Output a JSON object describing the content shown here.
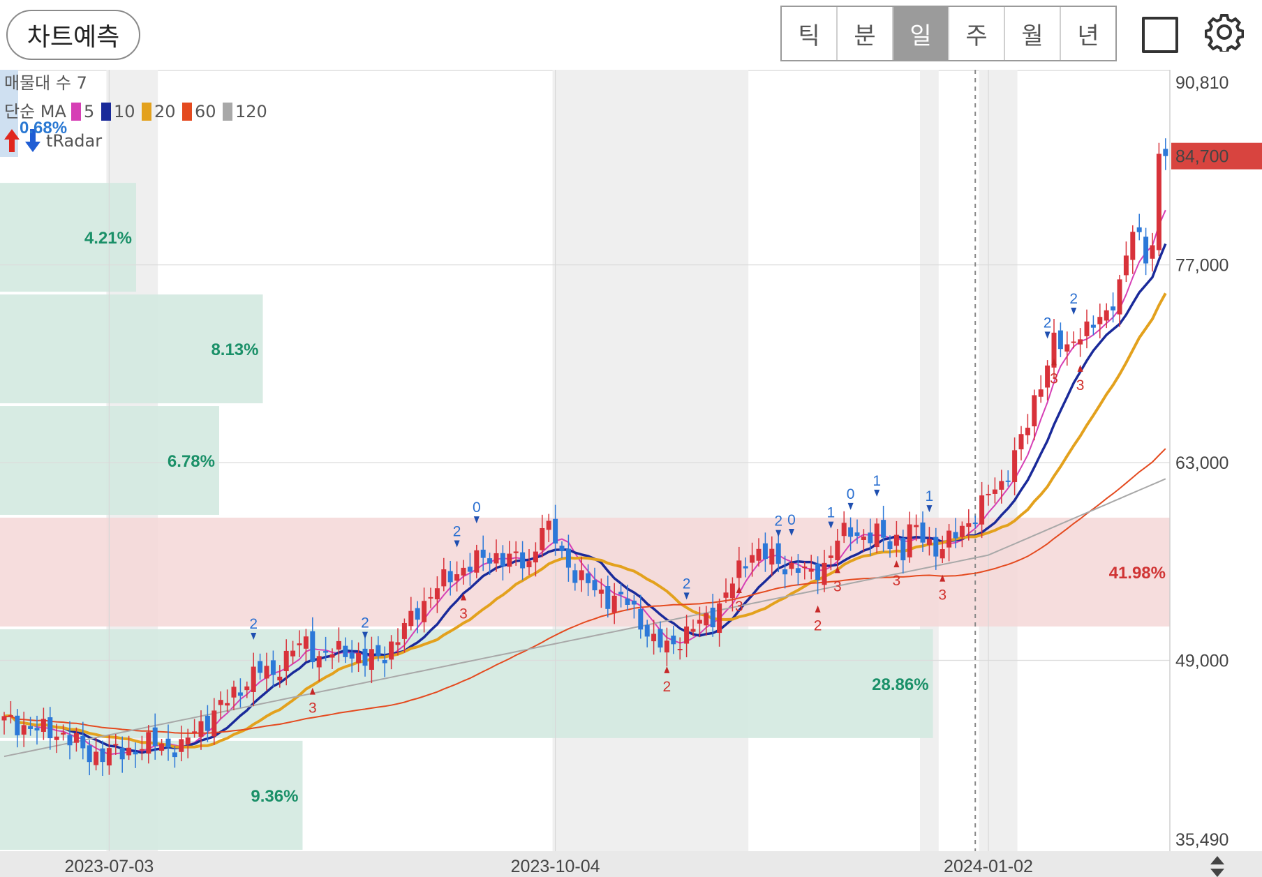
{
  "toolbar": {
    "predict_label": "차트예측",
    "tabs": [
      {
        "label": "틱",
        "active": false
      },
      {
        "label": "분",
        "active": false
      },
      {
        "label": "일",
        "active": true
      },
      {
        "label": "주",
        "active": false
      },
      {
        "label": "월",
        "active": false
      },
      {
        "label": "년",
        "active": false
      }
    ],
    "square_icon": "square-icon",
    "settings_icon": "gear-icon"
  },
  "legend": {
    "volume_profile_label": "매물대 수 7",
    "ma_label": "단순 MA",
    "ma_periods": [
      "5",
      "10",
      "20",
      "60",
      "120"
    ],
    "ma_colors": [
      "#d63fb5",
      "#1a2a9a",
      "#e3a11d",
      "#e44a1f",
      "#a8a8a8"
    ],
    "signal_label": "tRadar",
    "profile_top_pct": "0.68%"
  },
  "chart_data": {
    "type": "candlestick",
    "y_ticks": [
      "90,810",
      "77,000",
      "63,000",
      "49,000",
      "35,490"
    ],
    "y_range": [
      35490,
      90810
    ],
    "x_ticks": [
      "2023-07-03",
      "2023-10-04",
      "2024-01-02"
    ],
    "last_price_label": "84,700",
    "last_price": 84700,
    "volume_profile": [
      {
        "label": "0.68%",
        "pct": 0.68,
        "low": 82900,
        "high": 90810
      },
      {
        "label": "4.21%",
        "pct": 4.21,
        "low": 75000,
        "high": 82900
      },
      {
        "label": "8.13%",
        "pct": 8.13,
        "low": 67100,
        "high": 75000
      },
      {
        "label": "6.78%",
        "pct": 6.78,
        "low": 59200,
        "high": 67100
      },
      {
        "label": "41.98%",
        "pct": 41.98,
        "low": 51300,
        "high": 59200,
        "highlight": true
      },
      {
        "label": "28.86%",
        "pct": 28.86,
        "low": 43400,
        "high": 51300
      },
      {
        "label": "9.36%",
        "pct": 9.36,
        "low": 35490,
        "high": 43400
      }
    ],
    "colors": {
      "up": "#d8323a",
      "down": "#2c78d8",
      "profile": "#d3e9e0",
      "profile_hl": "#f5d7d7",
      "pct_green": "#1a9068",
      "pct_red": "#d03434",
      "shade": "#efefef"
    },
    "close_path": [
      [
        0,
        44700
      ],
      [
        6,
        44000
      ],
      [
        9,
        43800
      ],
      [
        13,
        42300
      ],
      [
        18,
        42500
      ],
      [
        23,
        43200
      ],
      [
        27,
        42700
      ],
      [
        29,
        44100
      ],
      [
        32,
        45200
      ],
      [
        35,
        46700
      ],
      [
        37,
        47500
      ],
      [
        39,
        48300
      ],
      [
        41,
        48100
      ],
      [
        44,
        49700
      ],
      [
        46,
        50300
      ],
      [
        48,
        49200
      ],
      [
        52,
        49800
      ],
      [
        55,
        48900
      ],
      [
        58,
        49500
      ],
      [
        60,
        50600
      ],
      [
        63,
        52600
      ],
      [
        66,
        54200
      ],
      [
        69,
        55300
      ],
      [
        72,
        56000
      ],
      [
        75,
        56400
      ],
      [
        78,
        56100
      ],
      [
        80,
        55800
      ],
      [
        82,
        58600
      ],
      [
        84,
        57500
      ],
      [
        86,
        55700
      ],
      [
        88,
        54700
      ],
      [
        90,
        54000
      ],
      [
        92,
        53500
      ],
      [
        95,
        53100
      ],
      [
        97,
        51800
      ],
      [
        99,
        50300
      ],
      [
        101,
        49900
      ],
      [
        103,
        50600
      ],
      [
        105,
        51300
      ],
      [
        108,
        52200
      ],
      [
        110,
        53700
      ],
      [
        112,
        55300
      ],
      [
        114,
        56800
      ],
      [
        116,
        56500
      ],
      [
        118,
        55800
      ],
      [
        121,
        55600
      ],
      [
        123,
        54900
      ],
      [
        125,
        55800
      ],
      [
        127,
        57600
      ],
      [
        129,
        58100
      ],
      [
        131,
        57800
      ],
      [
        133,
        57900
      ],
      [
        135,
        57200
      ],
      [
        136,
        57700
      ],
      [
        137,
        56800
      ],
      [
        138,
        58300
      ],
      [
        140,
        57700
      ],
      [
        142,
        56900
      ],
      [
        144,
        57400
      ],
      [
        146,
        58300
      ],
      [
        148,
        59400
      ],
      [
        150,
        60700
      ],
      [
        152,
        61400
      ],
      [
        154,
        63700
      ],
      [
        156,
        65600
      ],
      [
        158,
        68800
      ],
      [
        160,
        71700
      ],
      [
        162,
        70800
      ],
      [
        164,
        72500
      ],
      [
        166,
        72700
      ],
      [
        168,
        73300
      ],
      [
        170,
        75900
      ],
      [
        172,
        79400
      ],
      [
        174,
        77600
      ],
      [
        175,
        78700
      ],
      [
        176,
        84700
      ]
    ],
    "x_tick_index": [
      16,
      84,
      150
    ],
    "shaded_index": [
      [
        16,
        23
      ],
      [
        84,
        113
      ],
      [
        140,
        142
      ],
      [
        149,
        154
      ]
    ],
    "dashed_index": 148
  }
}
